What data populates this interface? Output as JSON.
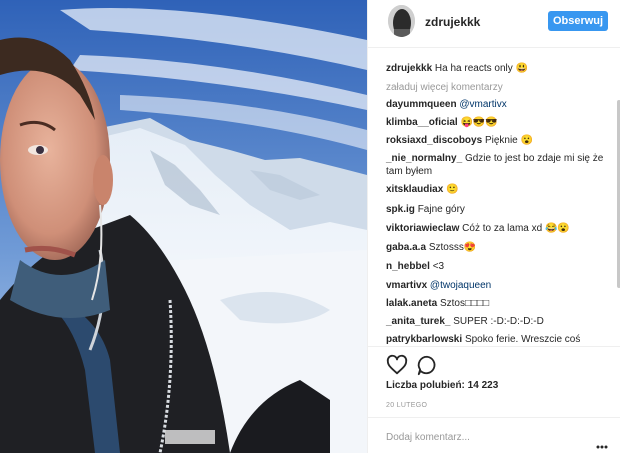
{
  "header": {
    "username": "zdrujekkk",
    "follow_label": "Obserwuj"
  },
  "caption": {
    "author": "zdrujekkk",
    "text": "Ha ha reacts only 😃"
  },
  "load_more_label": "załaduj więcej komentarzy",
  "comments": [
    {
      "author": "dayummqueen",
      "text": "",
      "mention": "@vmartivx"
    },
    {
      "author": "klimba__oficial",
      "text": "😝😎😎",
      "mention": ""
    },
    {
      "author": "roksiaxd_discoboys",
      "text": "Pięknie 😮",
      "mention": ""
    },
    {
      "author": "_nie_normalny_",
      "text": "Gdzie to jest bo zdaje mi się że tam byłem",
      "mention": ""
    },
    {
      "author": "xitsklaudiax",
      "text": "🙂",
      "mention": ""
    },
    {
      "author": "spk.ig",
      "text": "Fajne góry",
      "mention": ""
    },
    {
      "author": "viktoriawieclaw",
      "text": "Cóż to za lama xd 😂😮",
      "mention": ""
    },
    {
      "author": "gaba.a.a",
      "text": "Sztosss😍",
      "mention": ""
    },
    {
      "author": "n_hebbel",
      "text": "<3",
      "mention": ""
    },
    {
      "author": "vmartivx",
      "text": "",
      "mention": "@twojaqueen"
    },
    {
      "author": "lalak.aneta",
      "text": "Sztos□□□□",
      "mention": ""
    },
    {
      "author": "_anita_turek_",
      "text": "SUPER :-D:-D:-D:-D",
      "mention": ""
    },
    {
      "author": "patrykbarlowski",
      "text": "Spoko ferie. Wreszcie coś",
      "mention": ""
    }
  ],
  "actions": {
    "like_icon": "heart-outline-icon",
    "comment_icon": "speech-bubble-icon"
  },
  "likes_label": "Liczba polubień: 14 223",
  "date_label": "20 LUTEGO",
  "add_comment_placeholder": "Dodaj komentarz...",
  "more_icon": "ellipsis-icon",
  "colors": {
    "accent": "#3897f0",
    "mention": "#003569",
    "muted": "#999999"
  }
}
